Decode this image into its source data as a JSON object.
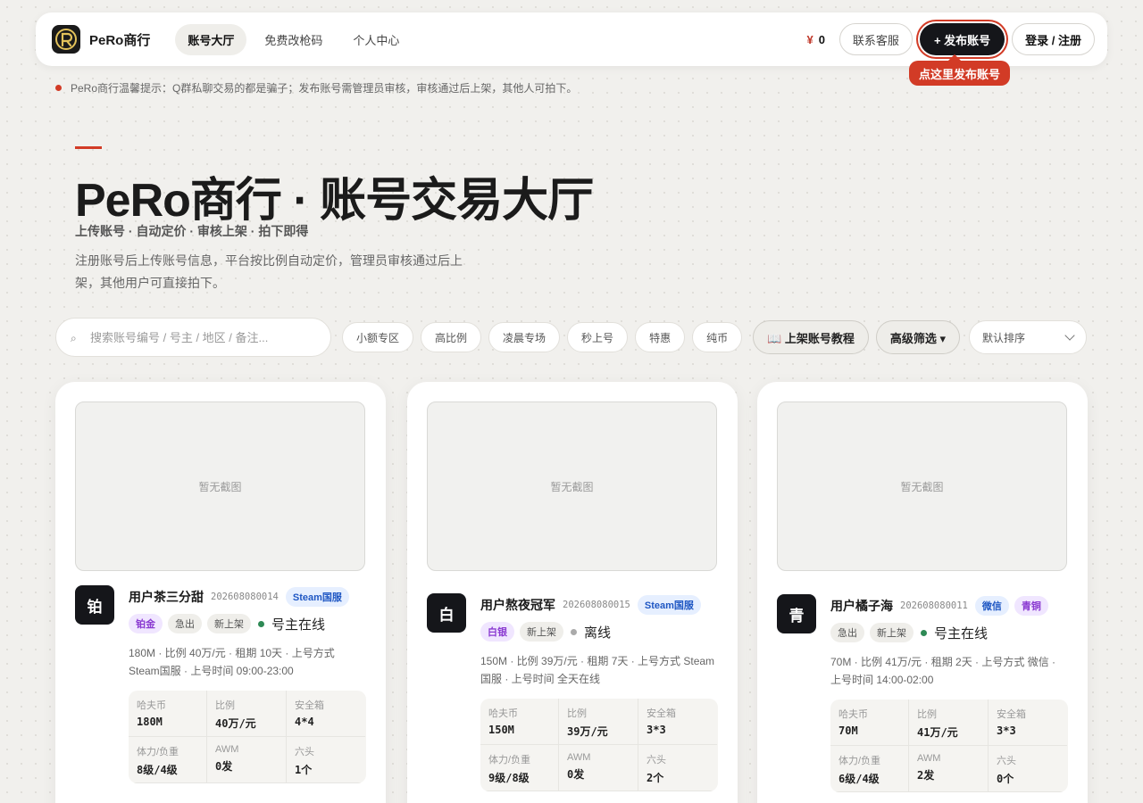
{
  "nav": {
    "brand": "PeRo商行",
    "links": [
      "账号大厅",
      "免费改枪码",
      "个人中心"
    ],
    "balance_symbol": "¥",
    "balance": "0",
    "support_label": "联系客服",
    "publish_label": "+ 发布账号",
    "login_label": "登录 / 注册",
    "tooltip": "点这里发布账号"
  },
  "notice": "PeRo商行温馨提示：Q群私聊交易的都是骗子；发布账号需管理员审核，审核通过后上架，其他人可拍下。",
  "hero": {
    "title": "PeRo商行 · 账号交易大厅",
    "subtitle": "上传账号 · 自动定价 · 审核上架 · 拍下即得",
    "desc": "注册账号后上传账号信息，平台按比例自动定价，管理员审核通过后上架，其他用户可直接拍下。"
  },
  "filters": {
    "search_placeholder": "搜索账号编号 / 号主 / 地区 / 备注...",
    "chips": [
      "小额专区",
      "高比例",
      "凌晨专场",
      "秒上号",
      "特惠",
      "纯币"
    ],
    "tutorial_label": "📖 上架账号教程",
    "advanced_label": "高级筛选 ▾",
    "sort_value": "默认排序"
  },
  "cards": [
    {
      "screenshot": "暂无截图",
      "badge": "铂",
      "name": "用户茶三分甜",
      "id": "202608080014",
      "platform": "Steam国服",
      "tags": [
        "铂金",
        "急出",
        "新上架"
      ],
      "status": "号主在线",
      "desc": "180M · 比例 40万/元 · 租期 10天 · 上号方式 Steam国服 · 上号时间 09:00-23:00",
      "stats": [
        {
          "k": "哈夫币",
          "v": "180M"
        },
        {
          "k": "比例",
          "v": "40万/元"
        },
        {
          "k": "安全箱",
          "v": "4*4"
        },
        {
          "k": "体力/负重",
          "v": "8级/4级"
        },
        {
          "k": "AWM",
          "v": "0发"
        },
        {
          "k": "六头",
          "v": "1个"
        }
      ]
    },
    {
      "screenshot": "暂无截图",
      "badge": "白",
      "name": "用户熬夜冠军",
      "id": "202608080015",
      "platform": "Steam国服",
      "tags": [
        "白银",
        "新上架"
      ],
      "status": "离线",
      "desc": "150M · 比例 39万/元 · 租期 7天 · 上号方式 Steam国服 · 上号时间 全天在线",
      "stats": [
        {
          "k": "哈夫币",
          "v": "150M"
        },
        {
          "k": "比例",
          "v": "39万/元"
        },
        {
          "k": "安全箱",
          "v": "3*3"
        },
        {
          "k": "体力/负重",
          "v": "9级/8级"
        },
        {
          "k": "AWM",
          "v": "0发"
        },
        {
          "k": "六头",
          "v": "2个"
        }
      ]
    },
    {
      "screenshot": "暂无截图",
      "badge": "青",
      "name": "用户橘子海",
      "id": "202608080011",
      "platform": "微信",
      "platform2": "青铜",
      "tags": [
        "急出",
        "新上架"
      ],
      "status": "号主在线",
      "desc": "70M · 比例 41万/元 · 租期 2天 · 上号方式 微信 · 上号时间 14:00-02:00",
      "stats": [
        {
          "k": "哈夫币",
          "v": "70M"
        },
        {
          "k": "比例",
          "v": "41万/元"
        },
        {
          "k": "安全箱",
          "v": "3*3"
        },
        {
          "k": "体力/负重",
          "v": "6级/4级"
        },
        {
          "k": "AWM",
          "v": "2发"
        },
        {
          "k": "六头",
          "v": "0个"
        }
      ]
    }
  ],
  "colors": {
    "accent": "#d23b26",
    "dark": "#15161a",
    "online": "#2e8a55"
  }
}
